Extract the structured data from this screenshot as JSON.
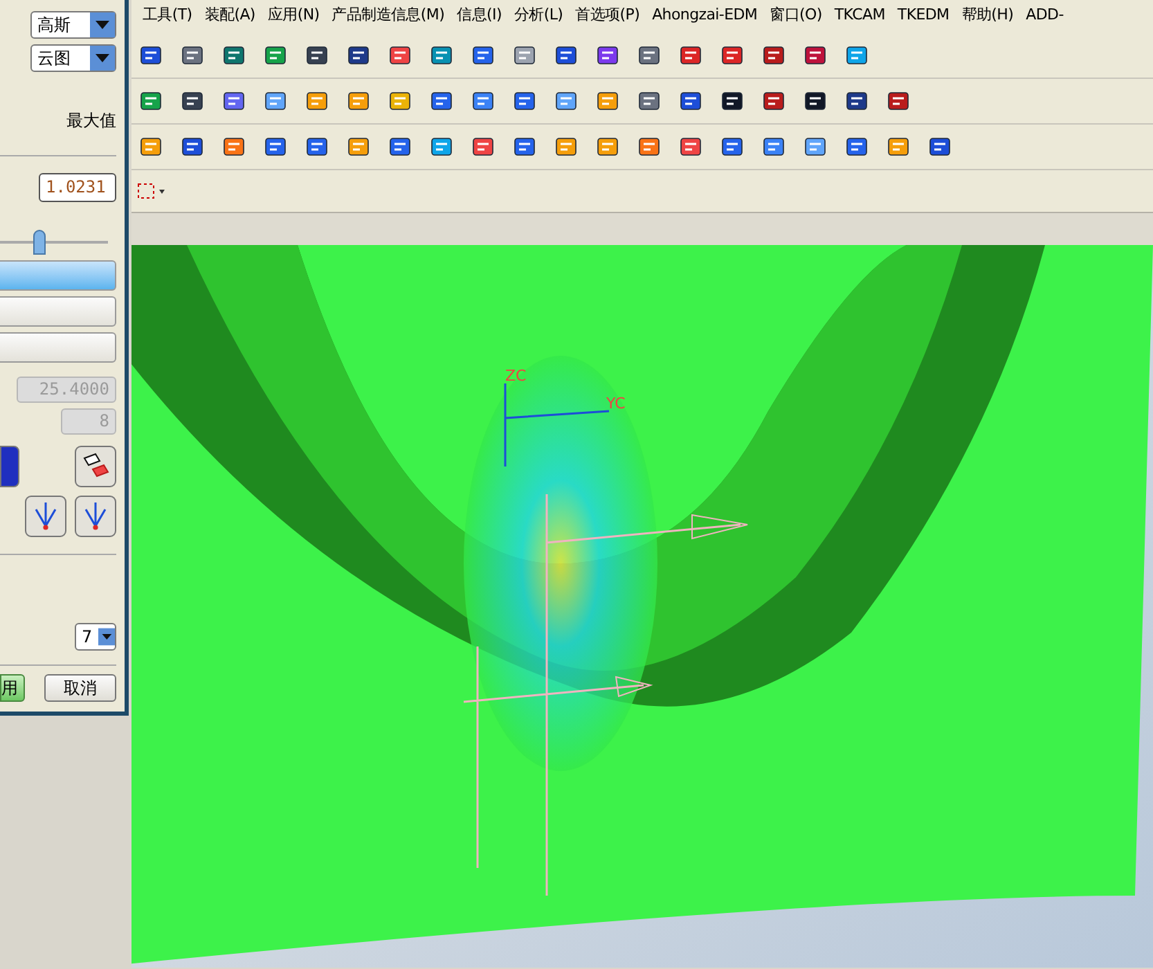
{
  "menu": [
    "工具(T)",
    "装配(A)",
    "应用(N)",
    "产品制造信息(M)",
    "信息(I)",
    "分析(L)",
    "首选项(P)",
    "Ahongzai-EDM",
    "窗口(O)",
    "TKCAM",
    "TKEDM",
    "帮助(H)",
    "ADD-"
  ],
  "dialog": {
    "dropdowns": [
      "高斯",
      "云图"
    ],
    "max_label": "最大值",
    "max_value": "1.0231",
    "slider": {
      "level": 0.36
    },
    "buttons": [
      {
        "selected": true
      },
      {
        "selected": false
      },
      {
        "selected": false
      }
    ],
    "disabled_fields": [
      "25.4000",
      "8"
    ],
    "count_dropdown": "7",
    "apply": "用",
    "cancel": "取消"
  },
  "viewport": {
    "axis_labels": [
      "ZC",
      "YC"
    ]
  }
}
